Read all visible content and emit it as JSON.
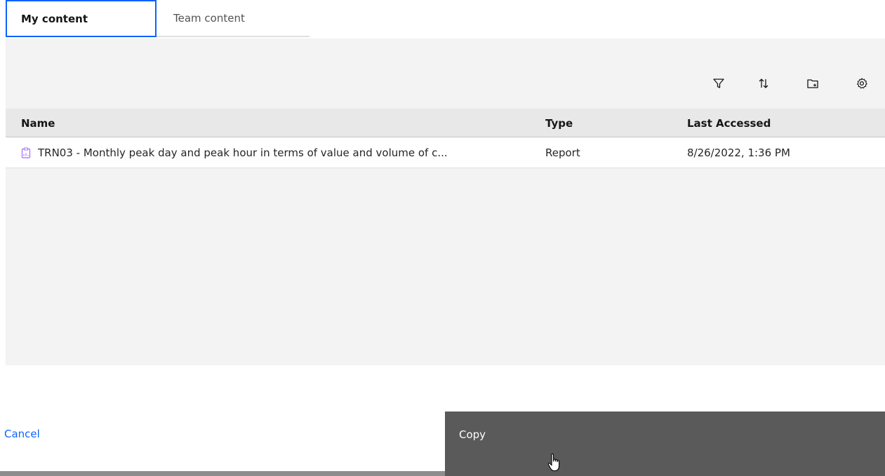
{
  "tabs": [
    {
      "label": "My content",
      "active": true
    },
    {
      "label": "Team content",
      "active": false
    }
  ],
  "toolbar": {
    "icons": [
      "filter-icon",
      "sort-icon",
      "new-folder-icon",
      "settings-icon"
    ]
  },
  "table": {
    "columns": [
      "Name",
      "Type",
      "Last Accessed"
    ],
    "rows": [
      {
        "icon": "report-icon",
        "name": "TRN03 - Monthly peak day and peak hour in terms of value and volume of c...",
        "type": "Report",
        "last_accessed": "8/26/2022, 1:36 PM"
      }
    ]
  },
  "footer": {
    "cancel_label": "Cancel",
    "copy_label": "Copy"
  },
  "colors": {
    "accent": "#0f62fe",
    "panel_bg": "#f3f3f3",
    "copy_button_bg": "#5a5a5a",
    "report_icon": "#a56eff"
  }
}
